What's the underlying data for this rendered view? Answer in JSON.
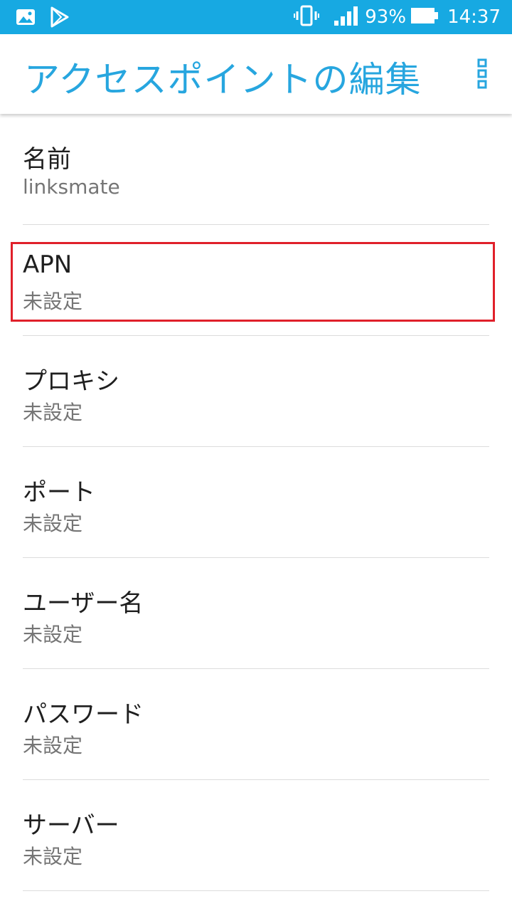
{
  "status_bar": {
    "battery_percent": "93%",
    "time": "14:37",
    "left_icons": [
      "gallery-icon",
      "play-store-icon"
    ],
    "right_icons": [
      "vibrate-icon",
      "signal-icon",
      "battery-icon"
    ],
    "background_color": "#17a9e2"
  },
  "app_bar": {
    "title": "アクセスポイントの編集",
    "title_color": "#27a6df",
    "menu_icon": "more-vert-icon"
  },
  "settings": [
    {
      "title": "名前",
      "value": "linksmate"
    },
    {
      "title": "APN",
      "value": "未設定"
    },
    {
      "title": "プロキシ",
      "value": "未設定"
    },
    {
      "title": "ポート",
      "value": "未設定"
    },
    {
      "title": "ユーザー名",
      "value": "未設定"
    },
    {
      "title": "パスワード",
      "value": "未設定"
    },
    {
      "title": "サーバー",
      "value": "未設定"
    }
  ],
  "highlight": {
    "target": "APN",
    "color": "#e0202a"
  }
}
